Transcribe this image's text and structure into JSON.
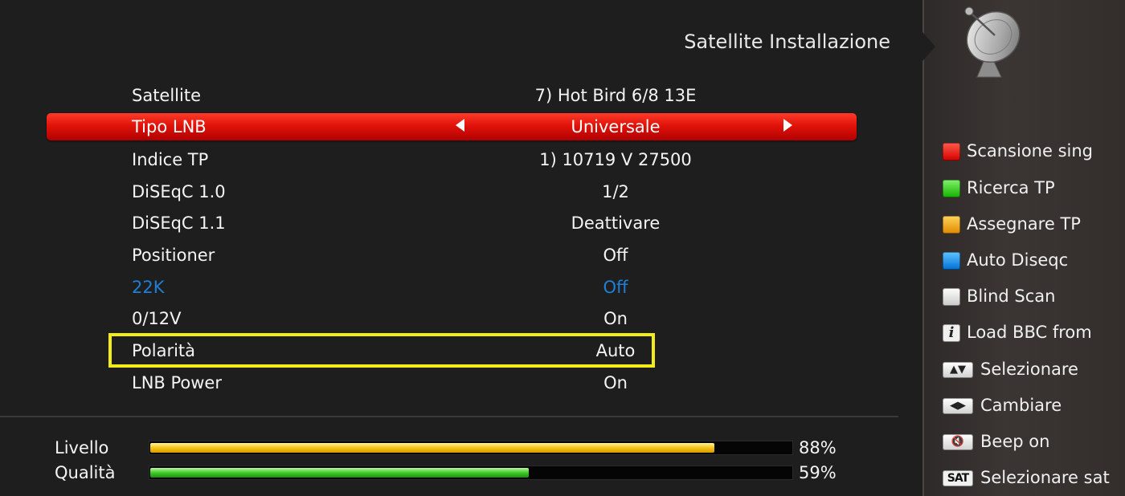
{
  "header": {
    "title": "Satellite Installazione"
  },
  "menu": [
    {
      "label": "Satellite",
      "value": "7) Hot Bird 6/8 13E",
      "state": "normal"
    },
    {
      "label": "Tipo LNB",
      "value": "Universale",
      "state": "selected"
    },
    {
      "label": "Indice TP",
      "value": "1) 10719 V 27500",
      "state": "normal"
    },
    {
      "label": "DiSEqC 1.0",
      "value": "1/2",
      "state": "normal"
    },
    {
      "label": "DiSEqC 1.1",
      "value": "Deattivare",
      "state": "normal"
    },
    {
      "label": "Positioner",
      "value": "Off",
      "state": "normal"
    },
    {
      "label": "22K",
      "value": "Off",
      "state": "disabled"
    },
    {
      "label": "0/12V",
      "value": "On",
      "state": "normal"
    },
    {
      "label": "Polarità",
      "value": "Auto",
      "state": "highlighted"
    },
    {
      "label": "LNB Power",
      "value": "On",
      "state": "normal"
    }
  ],
  "signal": {
    "level": {
      "label": "Livello",
      "percent_text": "88%",
      "fraction": 0.88,
      "color": "#f6c517"
    },
    "quality": {
      "label": "Qualità",
      "percent_text": "59%",
      "fraction": 0.59,
      "color": "#3fcc2a"
    }
  },
  "legend": [
    {
      "key": "red",
      "label": "Scansione sing"
    },
    {
      "key": "green",
      "label": "Ricerca TP"
    },
    {
      "key": "yellow",
      "label": "Assegnare TP"
    },
    {
      "key": "blue",
      "label": "Auto Diseqc"
    },
    {
      "key": "white",
      "label": "Blind Scan"
    },
    {
      "key": "info",
      "key_text": "i",
      "label": "Load BBC from"
    },
    {
      "key": "up-down",
      "key_text": "▲▼",
      "label": "Selezionare"
    },
    {
      "key": "left-right",
      "key_text": "◀▶",
      "label": "Cambiare"
    },
    {
      "key": "mute",
      "key_text": "🔇",
      "label": "Beep on"
    },
    {
      "key": "sat",
      "key_text": "SAT",
      "label": "Selezionare sat"
    }
  ],
  "colors": {
    "selected_bar": "#e0130a",
    "highlight_border": "#f3ec19",
    "disabled_text": "#1f7fd6"
  },
  "icons": {
    "header_icon": "satellite-dish-icon"
  }
}
